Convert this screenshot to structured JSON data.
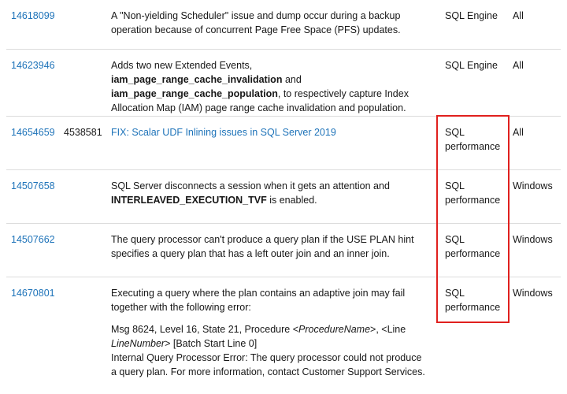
{
  "rows": [
    {
      "bug": "14618099",
      "kb": "",
      "desc": [
        [
          {
            "t": "A \"Non-yielding Scheduler\" issue and dump occur during a backup operation because of concurrent Page Free Space (PFS) updates."
          }
        ]
      ],
      "area": "SQL Engine",
      "platform": "All"
    },
    {
      "bug": "14623946",
      "kb": "",
      "desc": [
        [
          {
            "t": "Adds two new Extended Events, "
          },
          {
            "t": "iam_page_range_cache_invalidation",
            "b": true
          },
          {
            "t": " and "
          },
          {
            "t": "iam_page_range_cache_population",
            "b": true
          },
          {
            "t": ", to respectively capture Index Allocation Map (IAM) page range cache invalidation and population."
          }
        ]
      ],
      "area": "SQL Engine",
      "platform": "All"
    },
    {
      "bug": "14654659",
      "kb": "4538581",
      "desc": [
        [
          {
            "t": "FIX: Scalar UDF Inlining issues in SQL Server 2019",
            "link": true
          }
        ]
      ],
      "area": "SQL performance",
      "platform": "All"
    },
    {
      "bug": "14507658",
      "kb": "",
      "desc": [
        [
          {
            "t": "SQL Server disconnects a session when it gets an attention and "
          },
          {
            "t": "INTERLEAVED_EXECUTION_TVF",
            "b": true
          },
          {
            "t": " is enabled."
          }
        ]
      ],
      "area": "SQL performance",
      "platform": "Windows"
    },
    {
      "bug": "14507662",
      "kb": "",
      "desc": [
        [
          {
            "t": "The query processor can't produce a query plan if the USE PLAN hint specifies a query plan that has a left outer join and an inner join."
          }
        ]
      ],
      "area": "SQL performance",
      "platform": "Windows"
    },
    {
      "bug": "14670801",
      "kb": "",
      "desc": [
        [
          {
            "t": "Executing a query where the plan contains an adaptive join may fail together with the following error:"
          }
        ],
        [
          {
            "t": "Msg 8624, Level 16, State 21, Procedure <"
          },
          {
            "t": "ProcedureName",
            "i": true
          },
          {
            "t": ">, <Line "
          },
          {
            "t": "LineNumber",
            "i": true
          },
          {
            "t": "> [Batch Start Line 0]"
          },
          {
            "br": true
          },
          {
            "t": "Internal Query Processor Error: The query processor could not produce a query plan. For more information, contact Customer Support Services."
          }
        ]
      ],
      "area": "SQL performance",
      "platform": "Windows"
    }
  ],
  "colors": {
    "link": "#1e73b9",
    "highlight": "#e0201e",
    "border": "#dcdcdc"
  }
}
